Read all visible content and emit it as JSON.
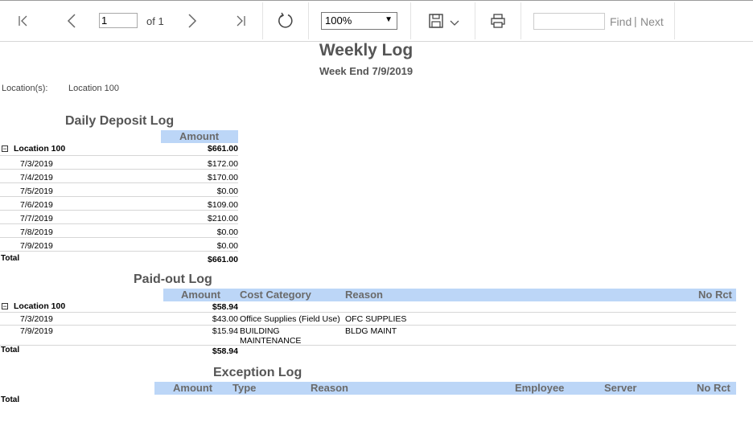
{
  "toolbar": {
    "page_value": "1",
    "of_label": "of 1",
    "zoom": "100%",
    "find_label": "Find",
    "find_separator": "|",
    "next_label": "Next"
  },
  "report": {
    "title": "Weekly Log",
    "subtitle": "Week End 7/9/2019",
    "locations_label": "Location(s):",
    "locations_value": "Location  100"
  },
  "deposit": {
    "title": "Daily Deposit Log",
    "col_amount": "Amount",
    "group_label": "Location 100",
    "group_total": "$661.00",
    "rows": [
      {
        "date": "7/3/2019",
        "amount": "$172.00"
      },
      {
        "date": "7/4/2019",
        "amount": "$170.00"
      },
      {
        "date": "7/5/2019",
        "amount": "$0.00"
      },
      {
        "date": "7/6/2019",
        "amount": "$109.00"
      },
      {
        "date": "7/7/2019",
        "amount": "$210.00"
      },
      {
        "date": "7/8/2019",
        "amount": "$0.00"
      },
      {
        "date": "7/9/2019",
        "amount": "$0.00"
      }
    ],
    "total_label": "Total",
    "total_value": "$661.00"
  },
  "paidout": {
    "title": "Paid-out Log",
    "col_amount": "Amount",
    "col_cost": "Cost Category",
    "col_reason": "Reason",
    "col_norct": "No Rct",
    "group_label": "Location 100",
    "group_total": "$58.94",
    "rows": [
      {
        "date": "7/3/2019",
        "amount": "$43.00",
        "cost": "Office Supplies (Field Use)",
        "reason": "OFC SUPPLIES"
      },
      {
        "date": "7/9/2019",
        "amount": "$15.94",
        "cost": "BUILDING MAINTENANCE",
        "reason": "BLDG MAINT"
      }
    ],
    "total_label": "Total",
    "total_value": "$58.94"
  },
  "exception": {
    "title": "Exception Log",
    "col_amount": "Amount",
    "col_type": "Type",
    "col_reason": "Reason",
    "col_employee": "Employee",
    "col_server": "Server",
    "col_norct": "No Rct",
    "total_label": "Total"
  }
}
